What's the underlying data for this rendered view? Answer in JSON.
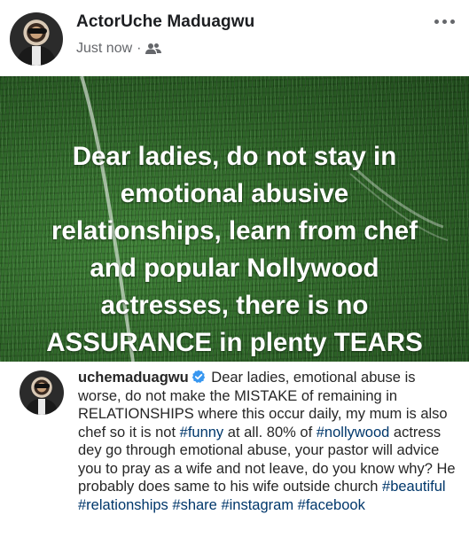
{
  "post": {
    "author": "ActorUche Maduagwu",
    "timestamp": "Just now",
    "separator": "·",
    "audience_icon": "friends-icon",
    "more_icon": "more-options-icon"
  },
  "banner": {
    "lines": [
      "Dear ladies, do not stay in",
      "emotional abusive",
      "relationships, learn from chef",
      "and popular Nollywood",
      "actresses, there is no",
      "ASSURANCE in plenty TEARS"
    ]
  },
  "instagram": {
    "username": "uchemaduagwu",
    "verified_icon": "verified-badge-icon",
    "caption_parts": [
      {
        "text": " Dear ladies, emotional abuse is worse, do not make the MISTAKE of remaining in RELATIONSHIPS where this occur daily, my mum is also chef so it is not ",
        "tag": false
      },
      {
        "text": "#funny",
        "tag": true
      },
      {
        "text": " at all. 80% of ",
        "tag": false
      },
      {
        "text": "#nollywood",
        "tag": true
      },
      {
        "text": " actress dey go through emotional abuse, your pastor will advice you to pray as a wife and not leave, do you know why? He probably does same to his wife outside church ",
        "tag": false
      },
      {
        "text": "#beautiful",
        "tag": true
      },
      {
        "text": " ",
        "tag": false
      },
      {
        "text": "#relationships",
        "tag": true
      },
      {
        "text": " ",
        "tag": false
      },
      {
        "text": "#share",
        "tag": true
      },
      {
        "text": " ",
        "tag": false
      },
      {
        "text": "#instagram",
        "tag": true
      },
      {
        "text": " ",
        "tag": false
      },
      {
        "text": "#facebook",
        "tag": true
      }
    ]
  },
  "colors": {
    "name_text": "#1c1e21",
    "meta_text": "#65676b",
    "hashtag": "#00376b",
    "verified": "#3897f0",
    "banner_text": "#ffffff"
  }
}
